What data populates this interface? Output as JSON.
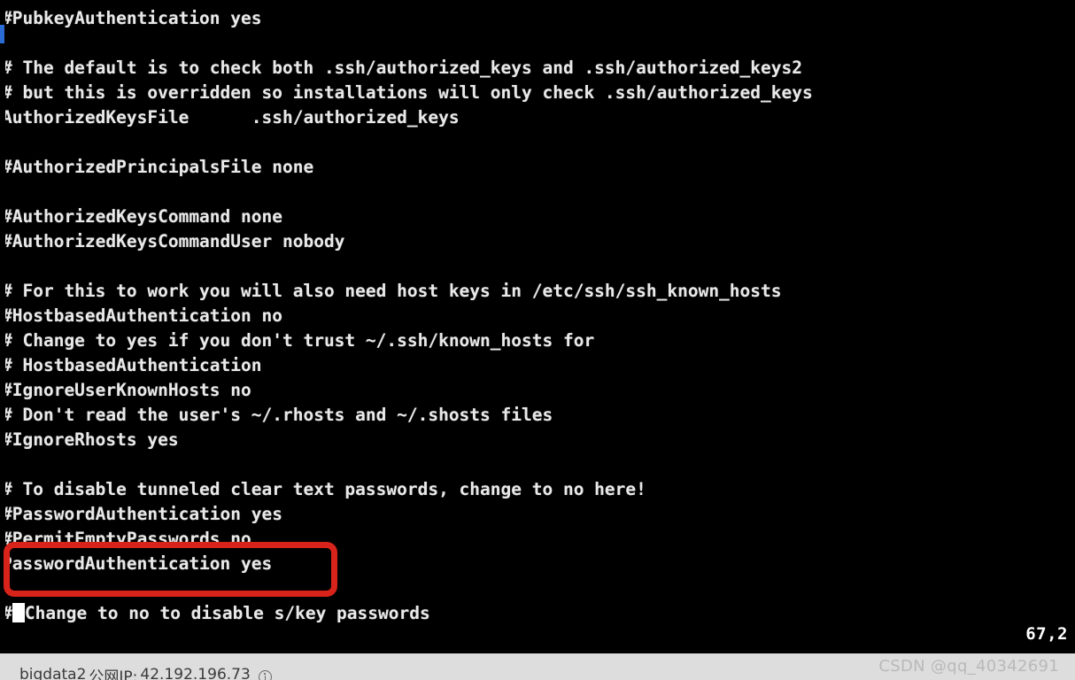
{
  "terminal": {
    "editor": "vi",
    "cursor_position": "67,2",
    "foreground_color": "#e9e9e9",
    "background_color": "#000000",
    "lines": [
      {
        "text": "#PubkeyAuthentication yes"
      },
      {
        "text": ""
      },
      {
        "text": "# The default is to check both .ssh/authorized_keys and .ssh/authorized_keys2"
      },
      {
        "text": "# but this is overridden so installations will only check .ssh/authorized_keys"
      },
      {
        "text": "AuthorizedKeysFile\t.ssh/authorized_keys"
      },
      {
        "text": ""
      },
      {
        "text": "#AuthorizedPrincipalsFile none"
      },
      {
        "text": ""
      },
      {
        "text": "#AuthorizedKeysCommand none"
      },
      {
        "text": "#AuthorizedKeysCommandUser nobody"
      },
      {
        "text": ""
      },
      {
        "text": "# For this to work you will also need host keys in /etc/ssh/ssh_known_hosts"
      },
      {
        "text": "#HostbasedAuthentication no"
      },
      {
        "text": "# Change to yes if you don't trust ~/.ssh/known_hosts for"
      },
      {
        "text": "# HostbasedAuthentication"
      },
      {
        "text": "#IgnoreUserKnownHosts no"
      },
      {
        "text": "# Don't read the user's ~/.rhosts and ~/.shosts files"
      },
      {
        "text": "#IgnoreRhosts yes"
      },
      {
        "text": ""
      },
      {
        "text": "# To disable tunneled clear text passwords, change to no here!"
      },
      {
        "text": "#PasswordAuthentication yes"
      },
      {
        "text": "#PermitEmptyPasswords no"
      },
      {
        "text": "PasswordAuthentication yes"
      },
      {
        "text": ""
      },
      {
        "text": "#█Change to no to disable s/key passwords"
      }
    ]
  },
  "annotation": {
    "highlight_color": "#d8231b",
    "highlighted_line": "PasswordAuthentication yes"
  },
  "status_bar": {
    "host_name": "bigdata2",
    "ip_label": "公网IP:",
    "ip_address": "42.192.196.73",
    "info_icon": "info-circle-icon",
    "watermark": "CSDN @qq_40342691",
    "background_color": "#dddddd"
  },
  "scrollbar": {
    "name": "vertical-scrollbar",
    "thumb_color": "#2a6bd4"
  }
}
